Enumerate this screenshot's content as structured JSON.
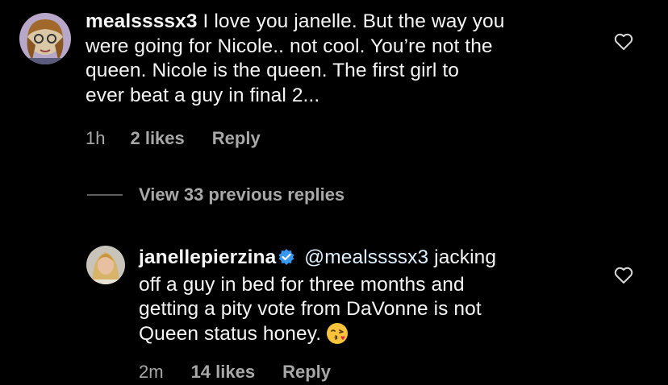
{
  "comments": [
    {
      "username": "mealssssx3",
      "text": "I love you janelle. But the way you were going for Nicole.. not cool. You’re not the queen. Nicole is the queen. The first girl to ever beat a guy in final 2...",
      "lines": [
        "were going for Nicole.. not cool. You’re not the",
        "queen. Nicole is the queen. The first girl to",
        "ever beat a guy in final 2..."
      ],
      "first_line": "I love you janelle. But the way you",
      "time": "1h",
      "likes": "2 likes",
      "reply": "Reply",
      "avatar_icon": "user-avatar-photo",
      "heart_icon": "heart-outline-icon"
    },
    {
      "username": "janellepierzina",
      "verified": true,
      "mention": "@mealssssx3",
      "first_line": "jacking",
      "lines": [
        "off a guy in bed for three months and",
        "getting a pity vote from DaVonne is not",
        "Queen status honey."
      ],
      "emoji": "face-blowing-a-kiss",
      "time": "2m",
      "likes": "14 likes",
      "reply": "Reply",
      "avatar_icon": "user-avatar-photo",
      "heart_icon": "heart-outline-icon"
    }
  ],
  "view_replies": {
    "label": "View 33 previous replies"
  },
  "colors": {
    "background": "#000000",
    "text": "#f5f5f5",
    "muted": "#a8a8a8",
    "verified": "#3897f0"
  }
}
